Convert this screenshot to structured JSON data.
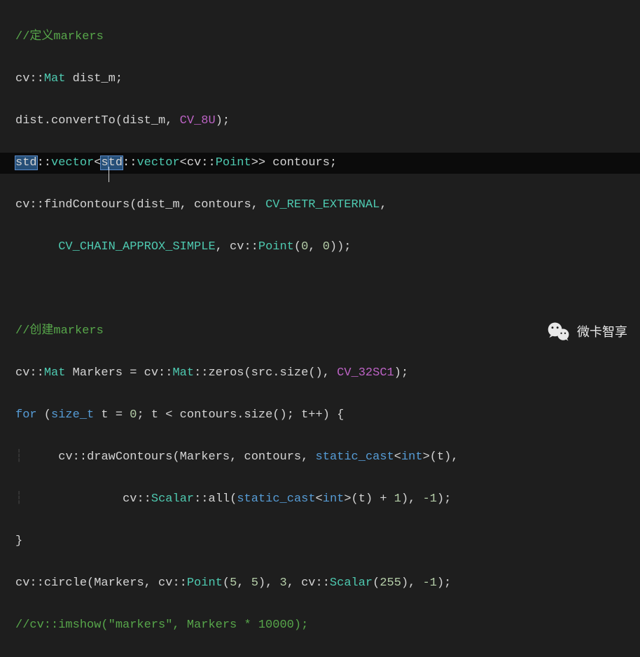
{
  "code": {
    "line1_comment": "//定义markers",
    "line2_ns": "cv",
    "line2_dc": "::",
    "line2_type": "Mat",
    "line2_sp": " ",
    "line2_var": "dist_m;",
    "line3_a": "dist.",
    "line3_b": "convertTo",
    "line3_c": "(dist_m, ",
    "line3_d": "CV_8U",
    "line3_e": ");",
    "line4_std1": "std",
    "line4_dc1": "::",
    "line4_vec1": "vector",
    "line4_lt1": "<",
    "line4_s": "s",
    "line4_td": "td",
    "line4_dc2": "::",
    "line4_vec2": "vector",
    "line4_lt2": "<",
    "line4_ns": "cv",
    "line4_dc3": "::",
    "line4_point": "Point",
    "line4_gtgt": ">>",
    "line4_rest": " contours;",
    "line5_a": "cv::",
    "line5_b": "findContours",
    "line5_c": "(dist_m, contours, ",
    "line5_d": "CV_RETR_EXTERNAL",
    "line5_e": ",",
    "line6_indent": "      ",
    "line6_a": "CV_CHAIN_APPROX_SIMPLE",
    "line6_b": ", cv::",
    "line6_c": "Point",
    "line6_d": "(",
    "line6_e": "0",
    "line6_f": ", ",
    "line6_g": "0",
    "line6_h": "));",
    "line7_blank": " ",
    "line8_comment": "//创建markers",
    "line9_a": "cv::",
    "line9_b": "Mat",
    "line9_c": " Markers = cv::",
    "line9_d": "Mat",
    "line9_e": "::",
    "line9_f": "zeros",
    "line9_g": "(src.",
    "line9_h": "size",
    "line9_i": "(), ",
    "line9_j": "CV_32SC1",
    "line9_k": ");",
    "line10_a": "for",
    "line10_b": " (",
    "line10_c": "size_t",
    "line10_d": " t = ",
    "line10_e": "0",
    "line10_f": "; t < contours.",
    "line10_g": "size",
    "line10_h": "(); t++) {",
    "line11_guide": "┆",
    "line11_indent": "     ",
    "line11_a": "cv::",
    "line11_b": "drawContours",
    "line11_c": "(Markers, contours, ",
    "line11_d": "static_cast",
    "line11_e": "<",
    "line11_f": "int",
    "line11_g": ">(t),",
    "line12_guide": "┆",
    "line12_indent": "              ",
    "line12_a": "cv::",
    "line12_b": "Scalar",
    "line12_c": "::",
    "line12_d": "all",
    "line12_e": "(",
    "line12_f": "static_cast",
    "line12_g": "<",
    "line12_h": "int",
    "line12_i": ">(t) + ",
    "line12_j": "1",
    "line12_k": "), ",
    "line12_l": "-1",
    "line12_m": ");",
    "line13_brace": "}",
    "line14_a": "cv::",
    "line14_b": "circle",
    "line14_c": "(Markers, cv::",
    "line14_d": "Point",
    "line14_e": "(",
    "line14_f": "5",
    "line14_g": ", ",
    "line14_h": "5",
    "line14_i": "), ",
    "line14_j": "3",
    "line14_k": ", cv::",
    "line14_l": "Scalar",
    "line14_m": "(",
    "line14_n": "255",
    "line14_o": "), ",
    "line14_p": "-1",
    "line14_q": ");",
    "line15_comment": "//cv::imshow(\"markers\", Markers * 10000);"
  },
  "watermark": {
    "text": "微卡智享",
    "icon": "wechat-icon"
  }
}
